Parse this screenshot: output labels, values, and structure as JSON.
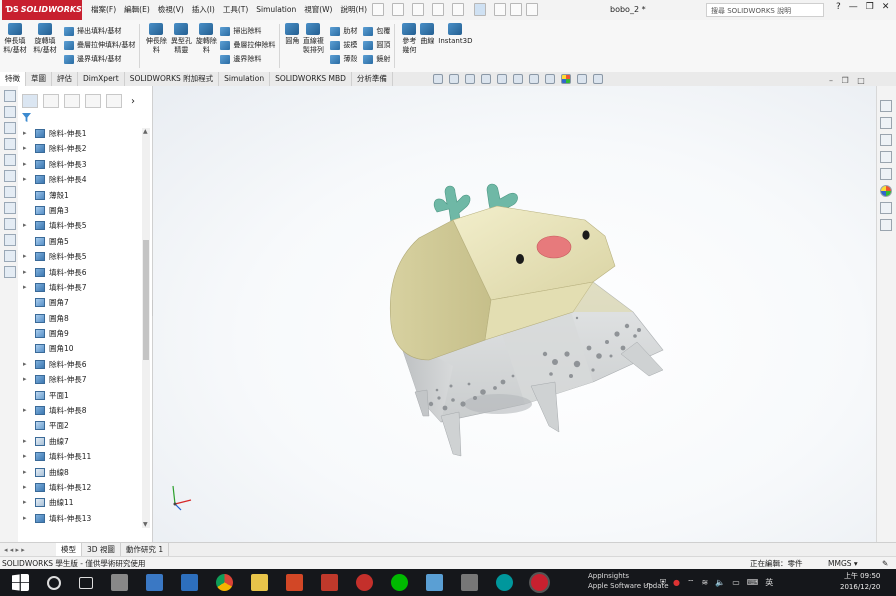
{
  "title_bar": {
    "brand": "SOLIDWORKS",
    "menus": [
      "檔案(F)",
      "編輯(E)",
      "檢視(V)",
      "插入(I)",
      "工具(T)",
      "Simulation",
      "視窗(W)",
      "說明(H)"
    ],
    "document_title": "bobo_2 *",
    "help_search_placeholder": "搜尋 SOLIDWORKS 說明",
    "window_controls": [
      "?",
      "—",
      "❐",
      "✕"
    ]
  },
  "command_manager": {
    "group1": [
      {
        "label": "伸長填料/基材",
        "icon": "extruded-boss-icon"
      },
      {
        "label": "旋轉填料/基材",
        "icon": "revolved-boss-icon"
      }
    ],
    "group2": [
      {
        "label": "掃出填料/基材",
        "icon": "swept-boss-icon"
      },
      {
        "label": "疊層拉伸填料/基材",
        "icon": "lofted-boss-icon"
      },
      {
        "label": "邊界填料/基材",
        "icon": "boundary-boss-icon"
      }
    ],
    "group3": [
      {
        "label": "伸長除料",
        "icon": "extruded-cut-icon"
      },
      {
        "label": "異型孔精靈",
        "icon": "hole-wizard-icon"
      },
      {
        "label": "旋轉除料",
        "icon": "revolved-cut-icon"
      }
    ],
    "group4": [
      {
        "label": "掃出除料",
        "icon": "swept-cut-icon"
      },
      {
        "label": "疊層拉伸除料",
        "icon": "lofted-cut-icon"
      },
      {
        "label": "邊界除料",
        "icon": "boundary-cut-icon"
      }
    ],
    "group5": [
      {
        "label": "圓角",
        "icon": "fillet-icon"
      },
      {
        "label": "直線複製排列",
        "icon": "linear-pattern-icon"
      }
    ],
    "group6": [
      {
        "label": "肋材",
        "icon": "rib-icon"
      },
      {
        "label": "拔模",
        "icon": "draft-icon"
      },
      {
        "label": "薄殼",
        "icon": "shell-icon"
      }
    ],
    "group7": [
      {
        "label": "包覆",
        "icon": "wrap-icon"
      },
      {
        "label": "圓頂",
        "icon": "dome-icon"
      },
      {
        "label": "鏡射",
        "icon": "mirror-icon"
      }
    ],
    "group8": [
      {
        "label": "參考幾何",
        "icon": "reference-geometry-icon"
      },
      {
        "label": "曲線",
        "icon": "curves-icon"
      },
      {
        "label": "Instant3D",
        "icon": "instant3d-icon"
      }
    ]
  },
  "tabs": [
    "特徵",
    "草圖",
    "評估",
    "DimXpert",
    "SOLIDWORKS 附加程式",
    "Simulation",
    "SOLIDWORKS MBD",
    "分析準備"
  ],
  "active_tab": "特徵",
  "feature_tree": [
    {
      "label": "除料-伸長1",
      "type": "cut",
      "expand": "▸"
    },
    {
      "label": "除料-伸長2",
      "type": "cut",
      "expand": "▸"
    },
    {
      "label": "除料-伸長3",
      "type": "cut",
      "expand": "▸"
    },
    {
      "label": "除料-伸長4",
      "type": "cut",
      "expand": "▸"
    },
    {
      "label": "薄殼1",
      "type": "shell",
      "expand": ""
    },
    {
      "label": "圓角3",
      "type": "fillet",
      "expand": ""
    },
    {
      "label": "填料-伸長5",
      "type": "boss",
      "expand": "▸"
    },
    {
      "label": "圓角5",
      "type": "fillet",
      "expand": ""
    },
    {
      "label": "除料-伸長5",
      "type": "cut",
      "expand": "▸"
    },
    {
      "label": "填料-伸長6",
      "type": "boss",
      "expand": "▸"
    },
    {
      "label": "填料-伸長7",
      "type": "boss",
      "expand": "▸"
    },
    {
      "label": "圓角7",
      "type": "fillet",
      "expand": ""
    },
    {
      "label": "圓角8",
      "type": "fillet",
      "expand": ""
    },
    {
      "label": "圓角9",
      "type": "fillet",
      "expand": ""
    },
    {
      "label": "圓角10",
      "type": "fillet",
      "expand": ""
    },
    {
      "label": "除料-伸長6",
      "type": "cut",
      "expand": "▸"
    },
    {
      "label": "除料-伸長7",
      "type": "cut",
      "expand": "▸"
    },
    {
      "label": "平面1",
      "type": "plane",
      "expand": ""
    },
    {
      "label": "填料-伸長8",
      "type": "boss",
      "expand": "▸"
    },
    {
      "label": "平面2",
      "type": "plane",
      "expand": ""
    },
    {
      "label": "曲線7",
      "type": "curve",
      "expand": "▸"
    },
    {
      "label": "填料-伸長11",
      "type": "boss",
      "expand": "▸"
    },
    {
      "label": "曲線8",
      "type": "curve",
      "expand": "▸"
    },
    {
      "label": "填料-伸長12",
      "type": "boss",
      "expand": "▸"
    },
    {
      "label": "曲線11",
      "type": "curve",
      "expand": "▸"
    },
    {
      "label": "填料-伸長13",
      "type": "boss",
      "expand": "▸"
    }
  ],
  "bottom_tabs": [
    "模型",
    "3D 視圖",
    "動作研究 1"
  ],
  "status": {
    "left": "SOLIDWORKS 學生版 - 僅供學術研究使用",
    "editing": "正在編輯：零件",
    "units": "MMGS",
    "units_caret": "▾"
  },
  "taskbar": {
    "notification_title": "AppInsights",
    "notification_sub": "Apple Software Update",
    "ime": "英",
    "time": "上午 09:50",
    "date": "2016/12/20"
  },
  "colors": {
    "brand_red": "#c8202f",
    "model_cream": "#e7e2b9",
    "model_grey": "#dadcdd",
    "antler_teal": "#6fb8a6",
    "nose_pink": "#e77a7c"
  }
}
